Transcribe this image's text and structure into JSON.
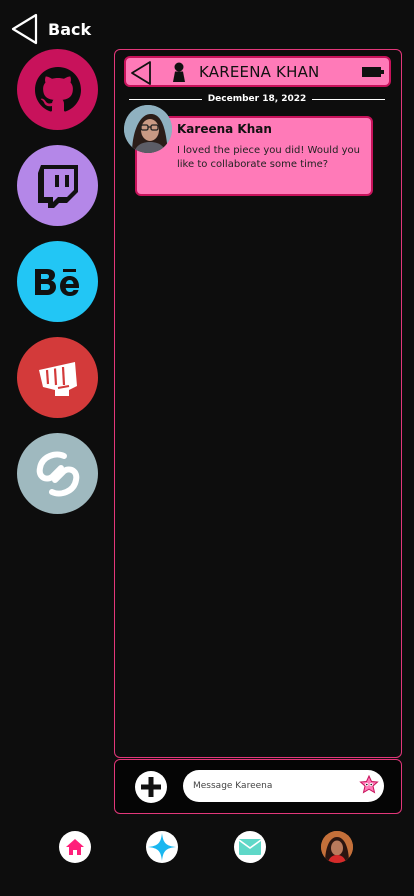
{
  "nav": {
    "back_label": "Back"
  },
  "social_links": [
    {
      "name": "github",
      "color": "#c8125b",
      "icon": "github-icon"
    },
    {
      "name": "twitch",
      "color": "#b487e8",
      "icon": "twitch-icon"
    },
    {
      "name": "behance",
      "color": "#22c6f5",
      "icon": "behance-icon",
      "text": "Bē"
    },
    {
      "name": "riot",
      "color": "#d33a3a",
      "icon": "riot-fist-icon"
    },
    {
      "name": "shazam",
      "color": "#9fb9bf",
      "icon": "shazam-icon"
    }
  ],
  "chat": {
    "contact_name": "KAREENA KHAN",
    "date": "December 18, 2022",
    "messages": [
      {
        "sender": "Kareena Khan",
        "text": "I loved the piece you did! Would you like to collaborate some time?"
      }
    ]
  },
  "composer": {
    "placeholder": "Message Kareena"
  },
  "bottom_nav": [
    {
      "name": "home",
      "icon": "home-icon"
    },
    {
      "name": "explore",
      "icon": "sparkle-icon"
    },
    {
      "name": "messages",
      "icon": "mail-icon"
    },
    {
      "name": "profile",
      "icon": "avatar"
    }
  ],
  "colors": {
    "accent": "#ff7ab8",
    "accent_border": "#c8125b",
    "background": "#0d0d0d"
  }
}
